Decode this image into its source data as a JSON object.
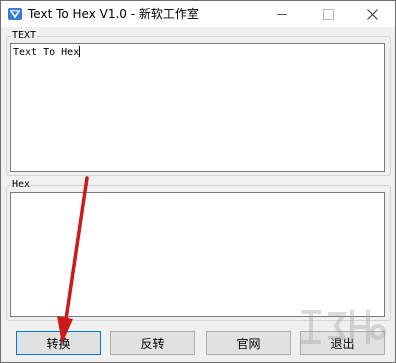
{
  "window": {
    "title": "Text To Hex V1.0 - 新软工作室"
  },
  "text_group": {
    "legend": "TEXT",
    "value": "Text To Hex"
  },
  "hex_group": {
    "legend": "Hex",
    "value": ""
  },
  "buttons": {
    "convert": "转换",
    "reverse": "反转",
    "website": "官网",
    "exit": "退出"
  },
  "annotation": {
    "arrow_color": "#cc1a1a"
  }
}
